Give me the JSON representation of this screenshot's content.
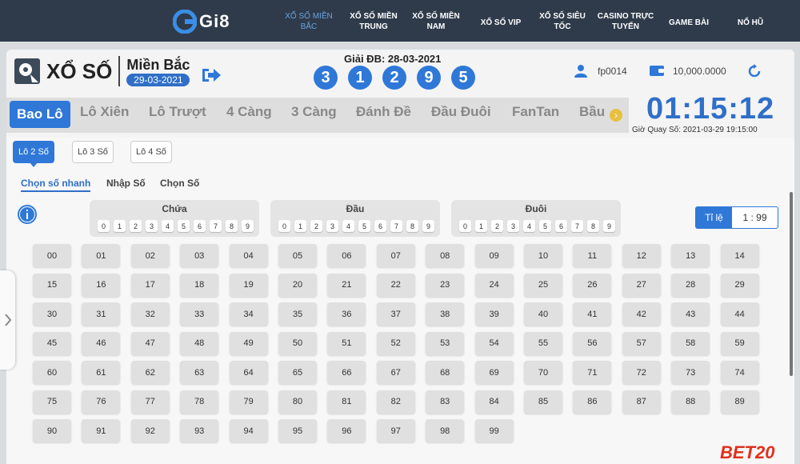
{
  "nav": {
    "logo": "Gi8",
    "items": [
      {
        "label": "XỔ SỐ MIỀN BẮC",
        "l1": "XỔ SỐ MIỀN",
        "l2": "BẮC"
      },
      {
        "label": "XỔ SỐ MIỀN TRUNG",
        "l1": "XỔ SỐ MIỀN",
        "l2": "TRUNG"
      },
      {
        "label": "XỔ SỐ MIỀN NAM",
        "l1": "XỔ SỐ MIỀN",
        "l2": "NAM"
      },
      {
        "label": "XỔ SỐ VIP",
        "l1": "XỔ SỐ VIP",
        "l2": ""
      },
      {
        "label": "XỔ SỐ SIÊU TỐC",
        "l1": "XỔ SỐ SIÊU",
        "l2": "TỐC"
      },
      {
        "label": "CASINO TRỰC TUYẾN",
        "l1": "CASINO TRỰC",
        "l2": "TUYẾN"
      },
      {
        "label": "GAME BÀI",
        "l1": "GAME BÀI",
        "l2": ""
      },
      {
        "label": "NỔ HŨ",
        "l1": "NỔ HŨ",
        "l2": ""
      }
    ],
    "active_index": 0
  },
  "header": {
    "game": "XỔ SỐ",
    "region": "Miền Bắc",
    "date": "29-03-2021",
    "result_label": "Giải ĐB: 28-03-2021",
    "result_digits": [
      "3",
      "1",
      "2",
      "9",
      "5"
    ],
    "username": "fp0014",
    "balance": "10,000.0000",
    "countdown": "01:15:12",
    "draw_time": "Giờ Quay Số: 2021-03-29 19:15:00"
  },
  "tabs": [
    "Bao Lô",
    "Lô Xiên",
    "Lô Trượt",
    "4 Càng",
    "3 Càng",
    "Đánh Đề",
    "Đầu Đuôi",
    "FanTan",
    "Bầu"
  ],
  "subtabs": [
    "Lô 2 Số",
    "Lô 3 Số",
    "Lô 4 Số"
  ],
  "modes": [
    "Chọn số nhanh",
    "Nhập Số",
    "Chọn Số"
  ],
  "filters": [
    {
      "title": "Chứa"
    },
    {
      "title": "Đầu"
    },
    {
      "title": "Đuôi"
    }
  ],
  "filter_digits": [
    "0",
    "1",
    "2",
    "3",
    "4",
    "5",
    "6",
    "7",
    "8",
    "9"
  ],
  "rate": {
    "label": "Tỉ lệ",
    "value": "1 : 99"
  },
  "watermark": "BET20",
  "colors": {
    "primary": "#2f78d8",
    "nav_bg": "#2f3b4b"
  }
}
